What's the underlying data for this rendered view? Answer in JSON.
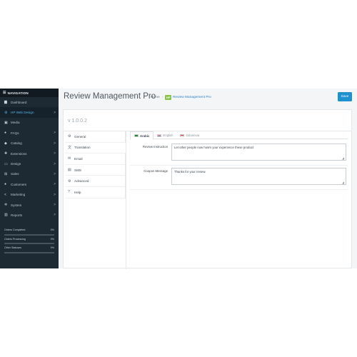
{
  "sidebar": {
    "header": "NAVIGATION",
    "items": [
      {
        "label": "Dashboard",
        "icon": "dashboard-icon",
        "glyph": "▆",
        "chev": ""
      },
      {
        "label": "HP Web Design",
        "icon": "cogs-icon",
        "glyph": "⚙",
        "chev": ">"
      },
      {
        "label": "Media",
        "icon": "image-icon",
        "glyph": "▣",
        "chev": ""
      },
      {
        "label": "FAQs",
        "icon": "comments-icon",
        "glyph": "●",
        "chev": ">"
      },
      {
        "label": "Catalog",
        "icon": "tag-icon",
        "glyph": "◆",
        "chev": ">"
      },
      {
        "label": "Extensions",
        "icon": "puzzle-icon",
        "glyph": "✚",
        "chev": ">"
      },
      {
        "label": "Design",
        "icon": "monitor-icon",
        "glyph": "▭",
        "chev": ">"
      },
      {
        "label": "Sales",
        "icon": "cart-icon",
        "glyph": "⊞",
        "chev": ">"
      },
      {
        "label": "Customers",
        "icon": "user-icon",
        "glyph": "●",
        "chev": ">"
      },
      {
        "label": "Marketing",
        "icon": "share-icon",
        "glyph": "<",
        "chev": ">"
      },
      {
        "label": "System",
        "icon": "gear-icon",
        "glyph": "✲",
        "chev": ">"
      },
      {
        "label": "Reports",
        "icon": "bar-chart-icon",
        "glyph": "▥",
        "chev": ">"
      }
    ],
    "active_index": 1,
    "stats": [
      {
        "label": "Orders Completed",
        "value": "0%",
        "fill": 0
      },
      {
        "label": "Orders Processing",
        "value": "0%",
        "fill": 0
      },
      {
        "label": "Other Statuses",
        "value": "0%",
        "fill": 0
      }
    ]
  },
  "header": {
    "title": "Review Management Pro",
    "breadcrumb_home": "Home",
    "breadcrumb_badge": "HP",
    "breadcrumb_current": "Review Management Pro",
    "save_label": "Save"
  },
  "panel": {
    "version": "v 1.0.0.2",
    "tabs": [
      {
        "label": "General",
        "icon": "gear-icon",
        "glyph": "⚙"
      },
      {
        "label": "Translation",
        "icon": "language-icon",
        "glyph": "文"
      },
      {
        "label": "Email",
        "icon": "email-icon",
        "glyph": "✉"
      },
      {
        "label": "SMS",
        "icon": "sms-icon",
        "glyph": "▤"
      },
      {
        "label": "Advanced",
        "icon": "cogs-icon",
        "glyph": "⚙"
      },
      {
        "label": "Help",
        "icon": "help-icon",
        "glyph": "?"
      }
    ],
    "active_tab": 1,
    "languages": [
      {
        "label": "Arabic",
        "flag": "ar"
      },
      {
        "label": "English",
        "flag": "en"
      },
      {
        "label": "Indonesia",
        "flag": "id"
      }
    ],
    "active_language": 0,
    "fields": [
      {
        "label": "Review Instruction",
        "value": "Let other people now how's your experience these product"
      },
      {
        "label": "Coupon Message",
        "value": "Thanks for your review."
      }
    ]
  },
  "colors": {
    "sidebar_bg": "#1e2a33",
    "accent": "#1e91cf",
    "active_nav_text": "#55b6e8",
    "badge": "#8bc34a"
  }
}
